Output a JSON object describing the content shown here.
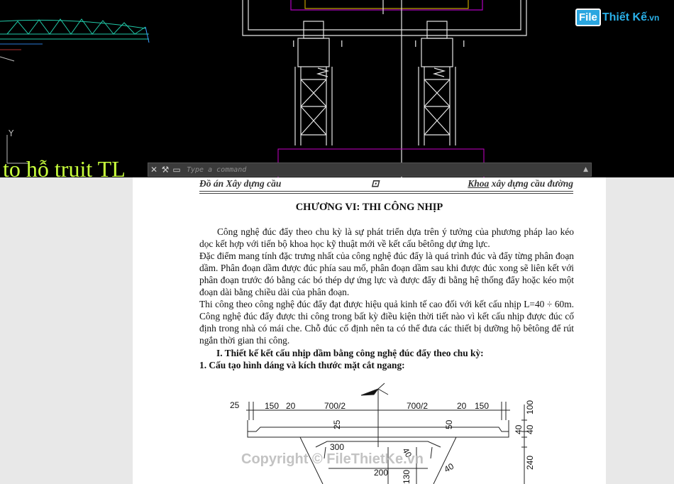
{
  "cad": {
    "background_color": "#000000",
    "cad_text": "to hỗ truịt TL",
    "axis_label": "Y",
    "column_labels": [
      "I",
      "I",
      "I",
      "I"
    ]
  },
  "command_line": {
    "placeholder": "Type a command",
    "icons": [
      "close-icon",
      "wrench-icon",
      "prompt-icon"
    ]
  },
  "logo": {
    "part1": "File",
    "part2": "Thiết Kế",
    "part3": ".vn"
  },
  "document": {
    "header": {
      "left": "Đồ án Xây dựng cầu",
      "middle": "⊡",
      "right_underlined": "Khoa",
      "right_rest": " xây dựng cầu  đường"
    },
    "chapter_title": "CHƯƠNG VI: THI CÔNG NHỊP",
    "paragraphs": [
      "Công nghệ đúc đẩy theo chu kỳ là sự phát triển dựa trên ý tưởng của phương pháp lao kéo dọc kết hợp với tiến bộ khoa học kỹ thuật mới về kết cấu bêtông dự ứng lực.",
      "Đặc điểm mang tính đặc trưng nhất của công nghệ đúc đẩy là quá trình đúc và đẩy từng phân đoạn dầm. Phân đoạn dầm được đúc phía sau mố, phân đoạn dầm sau khi được đúc xong sẽ liên kết với phân đoạn trước đó bằng các bó thép dự ứng lực và được đẩy đi bằng hệ thống đẩy hoặc kéo một đoạn dài bằng chiều dài của phân đoạn.",
      "Thi công theo công nghệ đúc đẩy đạt được hiệu quả kinh tế cao đối với kết cấu nhịp L=40 ÷ 60m. Công nghệ đúc đẩy được thi công trong bất kỳ điều kiện thời tiết nào vì kết cấu nhịp được đúc cố định trong nhà có mái che. Chỗ đúc cố định nên ta có thể đưa các thiết bị dưỡng hộ bêtông để rút ngắn thời gian thi công."
    ],
    "heading1": "I. Thiết kế kết cấu nhịp dầm bằng công nghệ đúc đẩy theo chu kỳ:",
    "heading2": "1. Cấu tạo hình dáng và kích thước mặt cắt ngang:",
    "section_dims": {
      "top": [
        "25",
        "150",
        "20",
        "700/2",
        "700/2",
        "20",
        "150"
      ],
      "right": [
        "100",
        "40",
        "40",
        "240"
      ],
      "inner": [
        "25",
        "50",
        "300",
        "50",
        "200",
        "130",
        "40",
        "40"
      ]
    }
  },
  "watermark": "Copyright © FileThietKe.vn",
  "colors": {
    "cad_cyan": "#00c8c8",
    "cad_white": "#ffffff",
    "cad_magenta": "#c800c8",
    "cad_yellow_green": "#c8ff3c",
    "logo_blue": "#2aa6e0"
  }
}
